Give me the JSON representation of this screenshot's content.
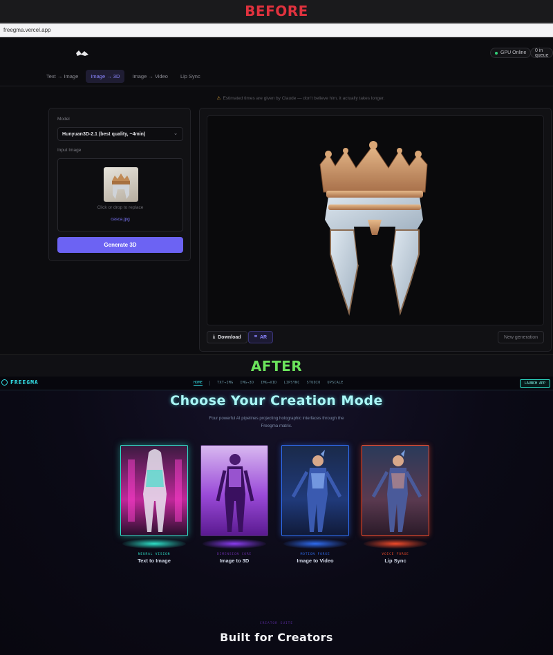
{
  "before_label": "BEFORE",
  "after_label": "AFTER",
  "browser": {
    "url": "freegma.vercel.app"
  },
  "before_app": {
    "status": {
      "gpu": "GPU Online",
      "queue": "0 in queue"
    },
    "tabs": [
      {
        "label": "Text → Image",
        "active": false
      },
      {
        "label": "Image → 3D",
        "active": true
      },
      {
        "label": "Image → Video",
        "active": false
      },
      {
        "label": "Lip Sync",
        "active": false
      }
    ],
    "notice": "Estimated times are given by Claude — don't believe him, it actually takes longer.",
    "model_label": "Model",
    "model_value": "Hunyuan3D-2.1 (best quality, ~4min)",
    "input_label": "Input Image",
    "drop_hint": "Click or drop to replace",
    "file_name": "casca.jpg",
    "generate_button": "Generate 3D",
    "download_button": "Download",
    "ar_button": "AR",
    "new_generation_button": "New generation",
    "colors": {
      "accent": "#6c63f3",
      "gpu_dot": "#33d17a"
    }
  },
  "after_app": {
    "brand": "FREEGMA",
    "nav": [
      "HOME",
      "TXT→IMG",
      "IMG→3D",
      "IMG→VID",
      "LIPSYNC",
      "STUDIO",
      "UPSCALE"
    ],
    "launch_button": "LAUNCH APP",
    "hero_title": "Choose Your Creation Mode",
    "hero_subtitle": "Four powerful AI pipelines projecting holographic interfaces through the Freegma matrix.",
    "cards": [
      {
        "tag": "NEURAL VISION",
        "name": "Text to Image",
        "color": "#2ee0c8"
      },
      {
        "tag": "DIMENSION CORE",
        "name": "Image to 3D",
        "color": "#8a3cf0"
      },
      {
        "tag": "MOTION FORGE",
        "name": "Image to Video",
        "color": "#2f6cf0"
      },
      {
        "tag": "VOICE FORGE",
        "name": "Lip Sync",
        "color": "#f04a2a"
      }
    ],
    "section_tag": "CREATOR SUITE",
    "section_title": "Built for Creators"
  }
}
